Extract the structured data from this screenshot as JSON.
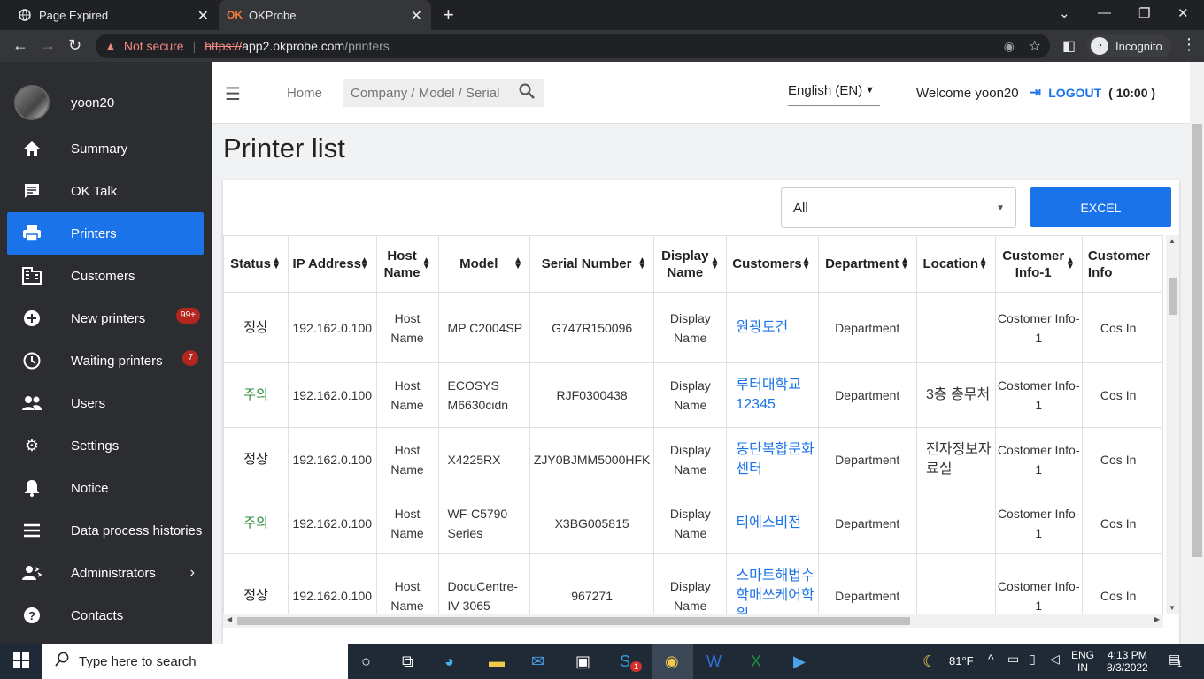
{
  "browser": {
    "tabs": [
      {
        "title": "Page Expired",
        "icon": "globe-icon"
      },
      {
        "title": "OKProbe",
        "icon": "okprobe-favicon"
      }
    ],
    "not_secure": "Not secure",
    "url_scheme": "https://",
    "url_host": "app2.okprobe.com",
    "url_path": "/printers",
    "incognito_label": "Incognito"
  },
  "sidebar": {
    "username": "yoon20",
    "items": [
      {
        "label": "Summary",
        "icon": "home-icon"
      },
      {
        "label": "OK Talk",
        "icon": "chat-icon"
      },
      {
        "label": "Printers",
        "icon": "printer-icon",
        "active": true
      },
      {
        "label": "Customers",
        "icon": "building-icon"
      },
      {
        "label": "New printers",
        "icon": "add-circle-icon",
        "badge": "99+"
      },
      {
        "label": "Waiting printers",
        "icon": "clock-icon",
        "badge": "7"
      },
      {
        "label": "Users",
        "icon": "people-icon"
      },
      {
        "label": "Settings",
        "icon": "gear-icon"
      },
      {
        "label": "Notice",
        "icon": "bell-icon"
      },
      {
        "label": "Data process histories",
        "icon": "list-icon"
      },
      {
        "label": "Administrators",
        "icon": "admin-icon"
      },
      {
        "label": "Contacts",
        "icon": "help-icon"
      }
    ]
  },
  "header": {
    "home": "Home",
    "search_placeholder": "Company / Model / Serial",
    "language": "English (EN)",
    "welcome": "Welcome yoon20",
    "logout": "LOGOUT",
    "timer": "( 10:00 )"
  },
  "page": {
    "title": "Printer list",
    "filter_value": "All",
    "excel_label": "EXCEL"
  },
  "table": {
    "columns": [
      "Status",
      "IP Address",
      "Host Name",
      "Model",
      "Serial Number",
      "Display Name",
      "Customers",
      "Department",
      "Location",
      "Customer Info-1",
      "Customer Info"
    ],
    "rows": [
      {
        "status": "정상",
        "status_type": "ok",
        "ip": "192.162.0.100",
        "host": "Host Name",
        "model": "MP C2004SP",
        "serial": "G747R150096",
        "display": "Display Name",
        "customer": "원광토건",
        "department": "Department",
        "location": "",
        "info1": "Costomer Info-1",
        "info2": "Cos In"
      },
      {
        "status": "주의",
        "status_type": "warn",
        "ip": "192.162.0.100",
        "host": "Host Name",
        "model": "ECOSYS M6630cidn",
        "serial": "RJF0300438",
        "display": "Display Name",
        "customer": "루터대학교 12345",
        "department": "Department",
        "location": "3층 총무처",
        "info1": "Costomer Info-1",
        "info2": "Cos In"
      },
      {
        "status": "정상",
        "status_type": "ok",
        "ip": "192.162.0.100",
        "host": "Host Name",
        "model": "X4225RX",
        "serial": "ZJY0BJMM5000HFK",
        "display": "Display Name",
        "customer": "동탄복합문화센터",
        "department": "Department",
        "location": "전자정보자료실",
        "info1": "Costomer Info-1",
        "info2": "Cos In"
      },
      {
        "status": "주의",
        "status_type": "warn",
        "ip": "192.162.0.100",
        "host": "Host Name",
        "model": "WF-C5790 Series",
        "serial": "X3BG005815",
        "display": "Display Name",
        "customer": "티에스비전",
        "department": "Department",
        "location": "",
        "info1": "Costomer Info-1",
        "info2": "Cos In"
      },
      {
        "status": "정상",
        "status_type": "ok",
        "ip": "192.162.0.100",
        "host": "Host Name",
        "model": "DocuCentre-IV 3065",
        "serial": "967271",
        "display": "Display Name",
        "customer": "스마트해법수학매쓰케어학원",
        "department": "Department",
        "location": "",
        "info1": "Costomer Info-1",
        "info2": "Cos In"
      }
    ]
  },
  "taskbar": {
    "search_placeholder": "Type here to search",
    "weather": "81°F",
    "lang_top": "ENG",
    "lang_bottom": "IN",
    "time": "4:13 PM",
    "date": "8/3/2022",
    "notif_count": "1",
    "skype_badge": "1"
  }
}
